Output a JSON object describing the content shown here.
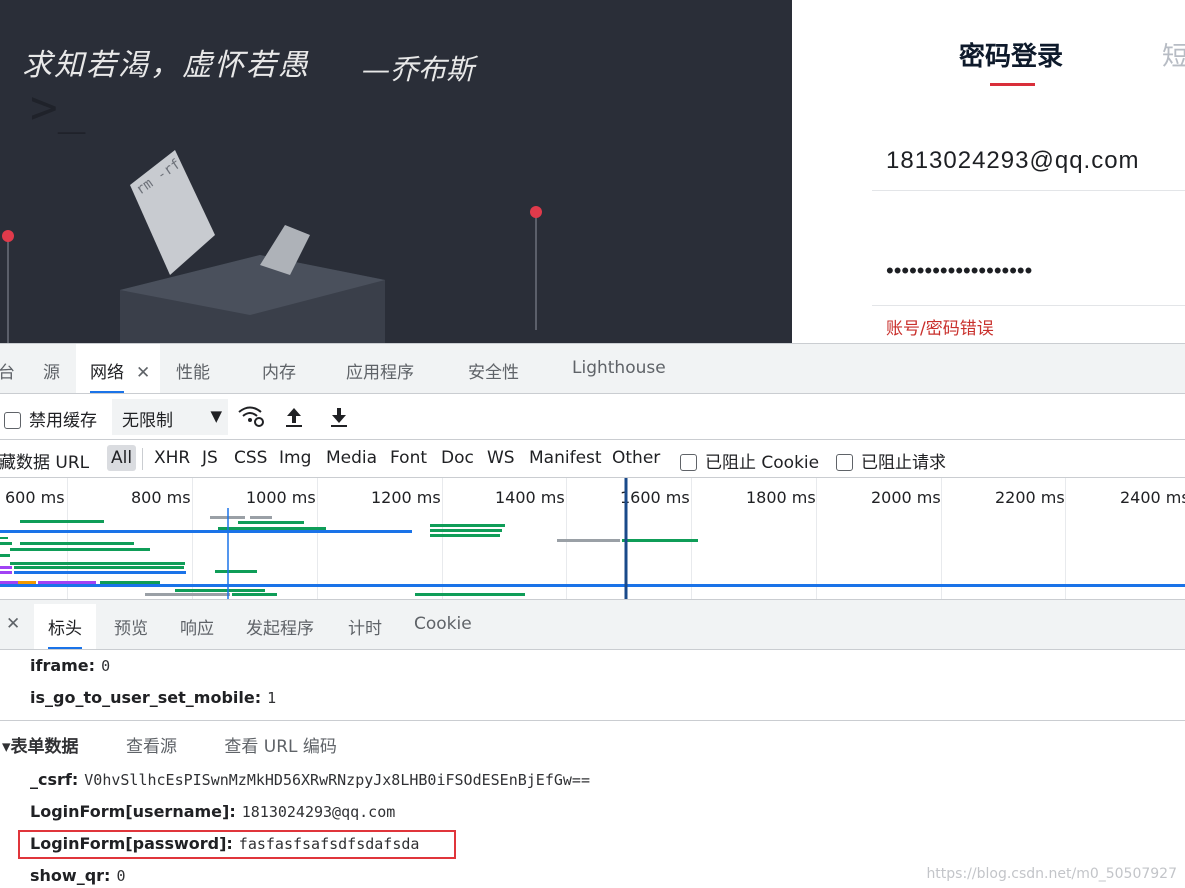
{
  "hero": {
    "quote": "求知若渴，虚怀若愚",
    "quote_author": "—乔布斯",
    "colors": {
      "background": "#2a2e38",
      "pin": "#e03a4b"
    }
  },
  "login": {
    "tab_password": "密码登录",
    "tab_sms_partial": "短",
    "username_value": "1813024293@qq.com",
    "password_masked": "•••••••••••••••••••",
    "error_text": "账号/密码错误",
    "colors": {
      "accent": "#d92e3a",
      "error": "#c9302c"
    }
  },
  "devtools": {
    "tabs": [
      {
        "label": "台"
      },
      {
        "label": "源"
      },
      {
        "label": "网络"
      },
      {
        "label": "性能"
      },
      {
        "label": "内存"
      },
      {
        "label": "应用程序"
      },
      {
        "label": "安全性"
      },
      {
        "label": "Lighthouse"
      }
    ],
    "close_glyph": "✕",
    "toolbar": {
      "disable_cache": "禁用缓存",
      "throttle_value": "无限制",
      "throttle_caret": "▼",
      "wifi_icon": "wifi-settings-icon",
      "upload_icon": "upload-icon",
      "download_icon": "download-icon"
    },
    "filter": {
      "hide_data_url": "隐藏数据 URL",
      "types": [
        "All",
        "XHR",
        "JS",
        "CSS",
        "Img",
        "Media",
        "Font",
        "Doc",
        "WS",
        "Manifest",
        "Other"
      ],
      "blocked_cookies": "已阻止 Cookie",
      "blocked_requests": "已阻止请求"
    },
    "timeline": {
      "ticks": [
        "600 ms",
        "800 ms",
        "1000 ms",
        "1200 ms",
        "1400 ms",
        "1600 ms",
        "1800 ms",
        "2000 ms",
        "2200 ms",
        "2400 ms"
      ],
      "colors": {
        "waiting": "#9aa0a6",
        "download": "#0f9d58",
        "blue": "#1a73e8",
        "purple": "#a142f4",
        "orange": "#f29900"
      }
    },
    "detail_tabs": [
      "标头",
      "预览",
      "响应",
      "发起程序",
      "计时",
      "Cookie"
    ],
    "query_params": [
      {
        "key": "iframe:",
        "value": "0"
      },
      {
        "key": "is_go_to_user_set_mobile:",
        "value": "1"
      }
    ],
    "form_section": {
      "title": "▾表单数据",
      "view_source": "查看源",
      "view_url_encoded": "查看 URL 编码"
    },
    "form_data": [
      {
        "key": "_csrf:",
        "value": "V0hvSllhcEsPISwnMzMkHD56XRwRNzpyJx8LHB0iFSOdESEnBjEfGw=="
      },
      {
        "key": "LoginForm[username]:",
        "value": "1813024293@qq.com"
      },
      {
        "key": "LoginForm[password]:",
        "value": "fasfasfsafsdfsdafsda"
      },
      {
        "key": "show_qr:",
        "value": "0"
      }
    ],
    "watermark": "https://blog.csdn.net/m0_50507927"
  }
}
